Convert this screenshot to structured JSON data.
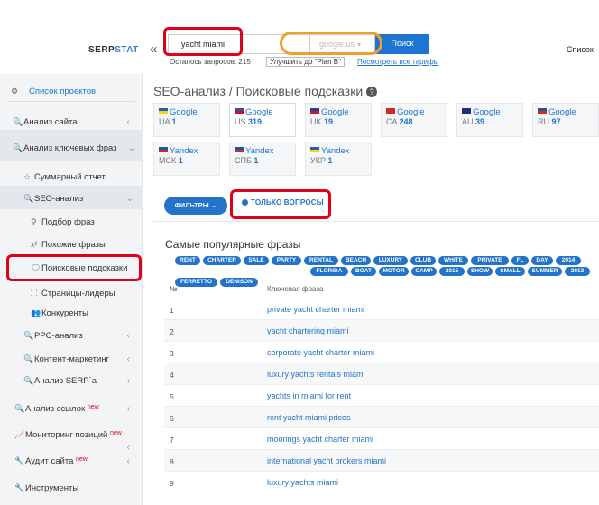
{
  "topbar": {
    "logo_left": "SERP",
    "logo_right": "STAT",
    "collapse_glyph": "«",
    "search_value": "yacht miami",
    "database_value": "google.us",
    "search_button": "Поиск",
    "limits_text": "Осталось запросов: 215",
    "upgrade_label": "Улучшить до \"Plan B\"",
    "tariffs_link": "Посмотреть все тарифы",
    "right_text": "Спиcок"
  },
  "sidebar": {
    "projects": "Список проектов",
    "items": [
      {
        "label": "Анализ сайта"
      },
      {
        "label": "Анализ ключевых фраз"
      },
      {
        "label": "Суммарный отчет"
      },
      {
        "label": "SEO-анализ"
      },
      {
        "label": "Подбор фраз"
      },
      {
        "label": "Похожие фразы"
      },
      {
        "label": "Поисковые подсказки"
      },
      {
        "label": "Страницы-лидеры"
      },
      {
        "label": "Конкуренты"
      },
      {
        "label": "PPC-анализ"
      },
      {
        "label": "Контент-маркетинг"
      },
      {
        "label": "Анализ SERP`а"
      },
      {
        "label": "Анализ ссылок",
        "badge": "new"
      },
      {
        "label": "Мониторинг позиций",
        "badge": "new"
      },
      {
        "label": "Аудит сайта",
        "badge": "new"
      },
      {
        "label": "Инструменты"
      }
    ]
  },
  "main": {
    "title": "SEO-анализ / Поисковые подсказки",
    "databases": [
      {
        "engine": "Google",
        "region": "UA",
        "count": "1",
        "flag_top": "#1f5fbf",
        "flag_bottom": "#ffd200"
      },
      {
        "engine": "Google",
        "region": "US",
        "count": "319",
        "flag_top": "#3b4f9a",
        "flag_bottom": "#c8102e"
      },
      {
        "engine": "Google",
        "region": "UK",
        "count": "19",
        "flag_top": "#2b3f8c",
        "flag_bottom": "#cf142b"
      },
      {
        "engine": "Google",
        "region": "CA",
        "count": "248",
        "flag_top": "#d52b1e",
        "flag_bottom": "#d52b1e"
      },
      {
        "engine": "Google",
        "region": "AU",
        "count": "39",
        "flag_top": "#1c2f7a",
        "flag_bottom": "#1c2f7a"
      },
      {
        "engine": "Google",
        "region": "RU",
        "count": "97",
        "flag_top": "#1c57a5",
        "flag_bottom": "#d52b1e"
      },
      {
        "engine": "Yandex",
        "region": "МСК",
        "count": "1",
        "flag_top": "#1c57a5",
        "flag_bottom": "#d52b1e"
      },
      {
        "engine": "Yandex",
        "region": "СПБ",
        "count": "1",
        "flag_top": "#1c57a5",
        "flag_bottom": "#d52b1e"
      },
      {
        "engine": "Yandex",
        "region": "УКР",
        "count": "1",
        "flag_top": "#1f5fbf",
        "flag_bottom": "#ffd200"
      }
    ],
    "filters_label": "ФИЛЬТРЫ",
    "only_questions_label": "ТОЛЬКО ВОПРОСЫ",
    "popular_title": "Самые популярные фразы",
    "tags": [
      "RENT",
      "CHARTER",
      "SALE",
      "PARTY",
      "RENTAL",
      "BEACH",
      "LUXURY",
      "CLUB",
      "WHITE",
      "PRIVATE",
      "FL",
      "DAY",
      "2014",
      "FLORIDA",
      "BOAT",
      "MOTOR",
      "CAMP",
      "2015",
      "SHOW",
      "SMALL",
      "SUMMER",
      "2013",
      "FERRETTO",
      "DENISON"
    ],
    "table": {
      "col_num": "№",
      "col_phrase": "Ключевая фраза",
      "rows": [
        {
          "num": "1",
          "phrase": "private yacht charter miami"
        },
        {
          "num": "2",
          "phrase": "yacht chartering miami"
        },
        {
          "num": "3",
          "phrase": "corporate yacht charter miami"
        },
        {
          "num": "4",
          "phrase": "luxury yachts rentals miami"
        },
        {
          "num": "5",
          "phrase": "yachts in miami for rent"
        },
        {
          "num": "6",
          "phrase": "rent yacht miami prices"
        },
        {
          "num": "7",
          "phrase": "moorings yacht charter miami"
        },
        {
          "num": "8",
          "phrase": "international yacht brokers miami"
        },
        {
          "num": "9",
          "phrase": "luxury yachts miami"
        }
      ]
    }
  },
  "colors": {
    "accent": "#1e74d3",
    "highlight_red": "#e0001b",
    "highlight_orange": "#f0a028",
    "new_badge": "#e0001b"
  }
}
